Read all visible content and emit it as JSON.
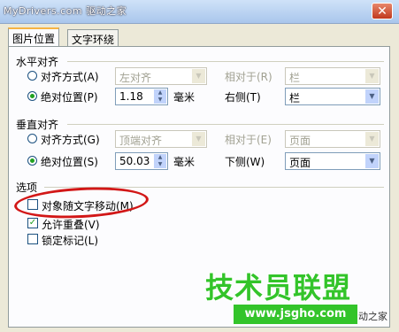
{
  "title": {
    "text": "MyDrivers.com 驱动之家"
  },
  "tabs": [
    {
      "label": "图片位置"
    },
    {
      "label": "文字环绕"
    }
  ],
  "horizontal": {
    "heading": "水平对齐",
    "align_label": "对齐方式(A)",
    "align_value": "左对齐",
    "rel_label": "相对于(R)",
    "rel_value": "栏",
    "abs_label": "绝对位置(P)",
    "abs_value": "1.18",
    "unit": "毫米",
    "right_label": "右侧(T)",
    "right_value": "栏"
  },
  "vertical": {
    "heading": "垂直对齐",
    "align_label": "对齐方式(G)",
    "align_value": "顶端对齐",
    "rel_label": "相对于(E)",
    "rel_value": "页面",
    "abs_label": "绝对位置(S)",
    "abs_value": "50.03",
    "unit": "毫米",
    "below_label": "下侧(W)",
    "below_value": "页面"
  },
  "options": {
    "heading": "选项",
    "items": [
      {
        "label": "对象随文字移动(M)",
        "checked": false
      },
      {
        "label": "允许重叠(V)",
        "checked": true
      },
      {
        "label": "锁定标记(L)",
        "checked": false
      }
    ]
  },
  "watermark": {
    "text": "技术员联盟",
    "url": "www.jsgho.com",
    "tail": "动之家"
  },
  "colors": {
    "highlight_ellipse": "#d21717",
    "watermark_green": "#33c42a"
  }
}
